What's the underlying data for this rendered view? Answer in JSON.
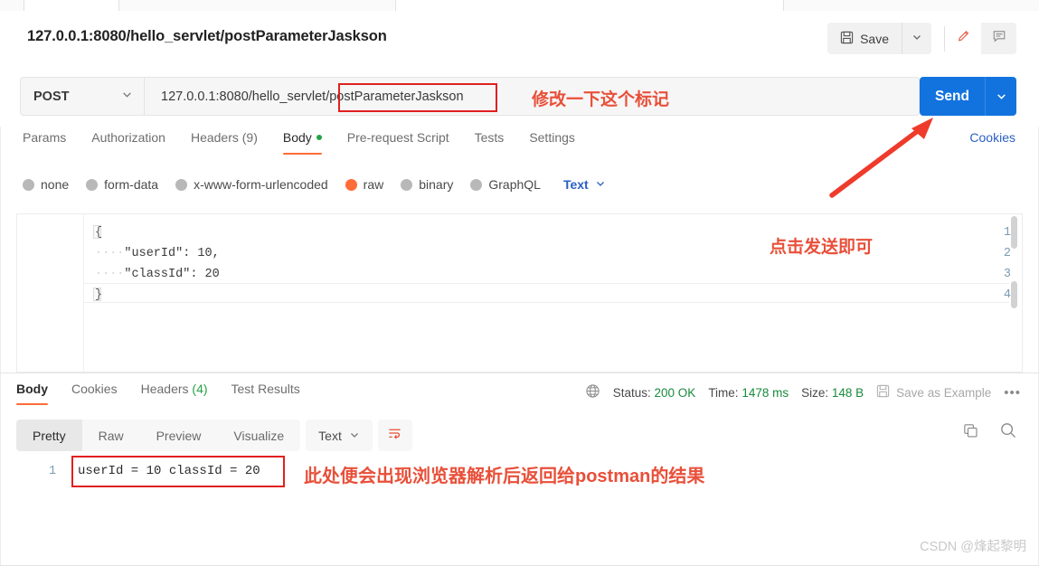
{
  "request_header": {
    "title": "127.0.0.1:8080/hello_servlet/postParameterJaskson",
    "save_label": "Save",
    "save_icon": "floppy-disk-icon",
    "save_caret_icon": "chevron-down-icon",
    "edit_icon": "pencil-icon",
    "comment_icon": "comment-icon"
  },
  "url_bar": {
    "method": "POST",
    "method_caret_icon": "chevron-down-icon",
    "url_prefix": "127.0.0.1:8080/hello_servlet/",
    "url_highlight": "postParameterJaskson",
    "send_label": "Send",
    "send_caret_icon": "chevron-down-icon",
    "send_color": "#1273de"
  },
  "request_tabs": {
    "items": [
      {
        "label": "Params",
        "active": false
      },
      {
        "label": "Authorization",
        "active": false
      },
      {
        "label": "Headers (9)",
        "active": false
      },
      {
        "label": "Body",
        "active": true,
        "dot": true
      },
      {
        "label": "Pre-request Script",
        "active": false
      },
      {
        "label": "Tests",
        "active": false
      },
      {
        "label": "Settings",
        "active": false
      }
    ],
    "cookies_label": "Cookies",
    "active_color": "#ff6c37"
  },
  "body_types": {
    "options": [
      {
        "label": "none",
        "selected": false
      },
      {
        "label": "form-data",
        "selected": false
      },
      {
        "label": "x-www-form-urlencoded",
        "selected": false
      },
      {
        "label": "raw",
        "selected": true
      },
      {
        "label": "binary",
        "selected": false
      },
      {
        "label": "GraphQL",
        "selected": false
      }
    ],
    "format_label": "Text",
    "format_caret_icon": "chevron-down-icon",
    "selected_color": "#ff6c37"
  },
  "editor": {
    "lines": [
      {
        "num": "1",
        "indent": "",
        "text": "{"
      },
      {
        "num": "2",
        "indent": "····",
        "text": "\"userId\": 10,"
      },
      {
        "num": "3",
        "indent": "····",
        "text": "\"classId\": 20"
      },
      {
        "num": "4",
        "indent": "",
        "text": "}"
      }
    ]
  },
  "response": {
    "tabs": [
      {
        "label": "Body",
        "active": true
      },
      {
        "label": "Cookies",
        "active": false
      },
      {
        "label": "Headers",
        "count": " (4)",
        "active": false
      },
      {
        "label": "Test Results",
        "active": false
      }
    ],
    "globe_icon": "globe-icon",
    "status_label": "Status:",
    "status_value": "200 OK",
    "time_label": "Time:",
    "time_value": "1478 ms",
    "size_label": "Size:",
    "size_value": "148 B",
    "save_example_label": "Save as Example",
    "save_example_icon": "floppy-disk-icon",
    "more_icon": "ellipsis-icon",
    "meta_value_color": "#1a8a3c"
  },
  "view_toolbar": {
    "segments": [
      {
        "label": "Pretty",
        "active": true
      },
      {
        "label": "Raw",
        "active": false
      },
      {
        "label": "Preview",
        "active": false
      },
      {
        "label": "Visualize",
        "active": false
      }
    ],
    "format_label": "Text",
    "format_caret_icon": "chevron-down-icon",
    "wrap_icon": "word-wrap-icon",
    "copy_icon": "copy-icon",
    "search_icon": "search-icon"
  },
  "response_body": {
    "line_number": "1",
    "content": "userId = 10 classId = 20"
  },
  "annotations": {
    "url_note": "修改一下这个标记",
    "send_note": "点击发送即可",
    "result_note": "此处便会出现浏览器解析后返回给postman的结果",
    "arrow_icon": "arrow-up-right-icon",
    "color": "#e8503a",
    "box_color": "#e02020"
  },
  "watermark": {
    "text": "CSDN @烽起黎明"
  }
}
